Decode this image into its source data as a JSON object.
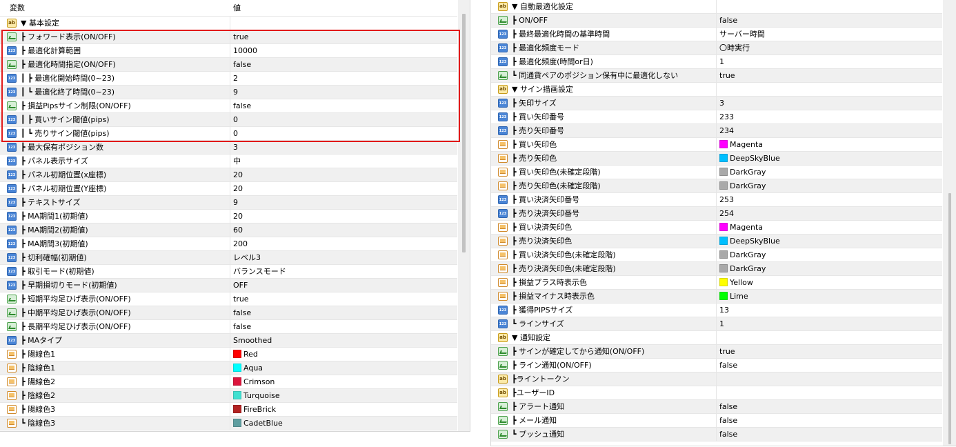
{
  "left": {
    "header": {
      "name": "変数",
      "value": "値"
    },
    "rows": [
      {
        "type": "str",
        "name": "▼ 基本設定",
        "value": ""
      },
      {
        "type": "bool",
        "name": "┣ フォワード表示(ON/OFF)",
        "value": "true"
      },
      {
        "type": "num",
        "name": "┣ 最適化計算範囲",
        "value": "10000"
      },
      {
        "type": "bool",
        "name": "┣ 最適化時間指定(ON/OFF)",
        "value": "false"
      },
      {
        "type": "num",
        "name": "┃ ┣ 最適化開始時間(0~23)",
        "value": "2"
      },
      {
        "type": "num",
        "name": "┃ ┗ 最適化終了時間(0~23)",
        "value": "9"
      },
      {
        "type": "bool",
        "name": "┣ 損益Pipsサイン制限(ON/OFF)",
        "value": "false"
      },
      {
        "type": "num",
        "name": "┃ ┣ 買いサイン閾値(pips)",
        "value": "0"
      },
      {
        "type": "num",
        "name": "┃ ┗ 売りサイン閾値(pips)",
        "value": "0"
      },
      {
        "type": "num",
        "name": "┣ 最大保有ポジション数",
        "value": "3"
      },
      {
        "type": "num",
        "name": "┣ パネル表示サイズ",
        "value": "中"
      },
      {
        "type": "num",
        "name": "┣ パネル初期位置(x座標)",
        "value": "20"
      },
      {
        "type": "num",
        "name": "┣ パネル初期位置(Y座標)",
        "value": "20"
      },
      {
        "type": "num",
        "name": "┣ テキストサイズ",
        "value": "9"
      },
      {
        "type": "num",
        "name": "┣ MA期間1(初期値)",
        "value": "20"
      },
      {
        "type": "num",
        "name": "┣ MA期間2(初期値)",
        "value": "60"
      },
      {
        "type": "num",
        "name": "┣ MA期間3(初期値)",
        "value": "200"
      },
      {
        "type": "num",
        "name": "┣ 切利確幅(初期値)",
        "value": "レベル3"
      },
      {
        "type": "num",
        "name": "┣ 取引モード(初期値)",
        "value": "バランスモード"
      },
      {
        "type": "num",
        "name": "┣ 早期損切りモード(初期値)",
        "value": "OFF"
      },
      {
        "type": "bool",
        "name": "┣ 短期平均足ひげ表示(ON/OFF)",
        "value": "true"
      },
      {
        "type": "bool",
        "name": "┣ 中期平均足ひげ表示(ON/OFF)",
        "value": "false"
      },
      {
        "type": "bool",
        "name": "┣ 長期平均足ひげ表示(ON/OFF)",
        "value": "false"
      },
      {
        "type": "num",
        "name": "┣ MAタイプ",
        "value": "Smoothed"
      },
      {
        "type": "color",
        "name": "┣ 陽線色1",
        "value": "Red",
        "swatch": "#ff0000"
      },
      {
        "type": "color",
        "name": "┣ 陰線色1",
        "value": "Aqua",
        "swatch": "#00ffff"
      },
      {
        "type": "color",
        "name": "┣ 陽線色2",
        "value": "Crimson",
        "swatch": "#dc143c"
      },
      {
        "type": "color",
        "name": "┣ 陰線色2",
        "value": "Turquoise",
        "swatch": "#40e0d0"
      },
      {
        "type": "color",
        "name": "┣ 陽線色3",
        "value": "FireBrick",
        "swatch": "#b22222"
      },
      {
        "type": "color",
        "name": "┗ 陰線色3",
        "value": "CadetBlue",
        "swatch": "#5f9ea0"
      }
    ]
  },
  "right": {
    "rows": [
      {
        "type": "str",
        "name": "▼ 自動最適化設定",
        "value": ""
      },
      {
        "type": "bool",
        "name": "┣ ON/OFF",
        "value": "false"
      },
      {
        "type": "num",
        "name": "┣ 最終最適化時間の基準時間",
        "value": "サーバー時間"
      },
      {
        "type": "num",
        "name": "┣ 最適化頻度モード",
        "value": "〇時実行"
      },
      {
        "type": "num",
        "name": "┣ 最適化頻度(時間or日)",
        "value": "1"
      },
      {
        "type": "bool",
        "name": "┗ 同通貨ペアのポジション保有中に最適化しない",
        "value": "true"
      },
      {
        "type": "str",
        "name": "▼ サイン描画設定",
        "value": ""
      },
      {
        "type": "num",
        "name": "┣ 矢印サイズ",
        "value": "3"
      },
      {
        "type": "num",
        "name": "┣ 買い矢印番号",
        "value": "233"
      },
      {
        "type": "num",
        "name": "┣ 売り矢印番号",
        "value": "234"
      },
      {
        "type": "color",
        "name": "┣ 買い矢印色",
        "value": "Magenta",
        "swatch": "#ff00ff"
      },
      {
        "type": "color",
        "name": "┣ 売り矢印色",
        "value": "DeepSkyBlue",
        "swatch": "#00bfff"
      },
      {
        "type": "color",
        "name": "┣ 買い矢印色(未確定段階)",
        "value": "DarkGray",
        "swatch": "#a9a9a9"
      },
      {
        "type": "color",
        "name": "┣ 売り矢印色(未確定段階)",
        "value": "DarkGray",
        "swatch": "#a9a9a9"
      },
      {
        "type": "num",
        "name": "┣ 買い決済矢印番号",
        "value": "253"
      },
      {
        "type": "num",
        "name": "┣ 売り決済矢印番号",
        "value": "254"
      },
      {
        "type": "color",
        "name": "┣ 買い決済矢印色",
        "value": "Magenta",
        "swatch": "#ff00ff"
      },
      {
        "type": "color",
        "name": "┣ 売り決済矢印色",
        "value": "DeepSkyBlue",
        "swatch": "#00bfff"
      },
      {
        "type": "color",
        "name": "┣ 買い決済矢印色(未確定段階)",
        "value": "DarkGray",
        "swatch": "#a9a9a9"
      },
      {
        "type": "color",
        "name": "┣ 売り決済矢印色(未確定段階)",
        "value": "DarkGray",
        "swatch": "#a9a9a9"
      },
      {
        "type": "color",
        "name": "┣ 損益プラス時表示色",
        "value": "Yellow",
        "swatch": "#ffff00"
      },
      {
        "type": "color",
        "name": "┣ 損益マイナス時表示色",
        "value": "Lime",
        "swatch": "#00ff00"
      },
      {
        "type": "num",
        "name": "┣ 獲得PIPSサイズ",
        "value": "13"
      },
      {
        "type": "num",
        "name": "┗ ラインサイズ",
        "value": "1"
      },
      {
        "type": "str",
        "name": "▼ 通知設定",
        "value": ""
      },
      {
        "type": "bool",
        "name": "┣ サインが確定してから通知(ON/OFF)",
        "value": "true"
      },
      {
        "type": "bool",
        "name": "┣ ライン通知(ON/OFF)",
        "value": "false"
      },
      {
        "type": "str",
        "name": "┣ライントークン",
        "value": ""
      },
      {
        "type": "str",
        "name": "┣ユーザーID",
        "value": ""
      },
      {
        "type": "bool",
        "name": "┣ アラート通知",
        "value": "false"
      },
      {
        "type": "bool",
        "name": "┣ メール通知",
        "value": "false"
      },
      {
        "type": "bool",
        "name": "┗ プッシュ通知",
        "value": "false"
      }
    ]
  }
}
